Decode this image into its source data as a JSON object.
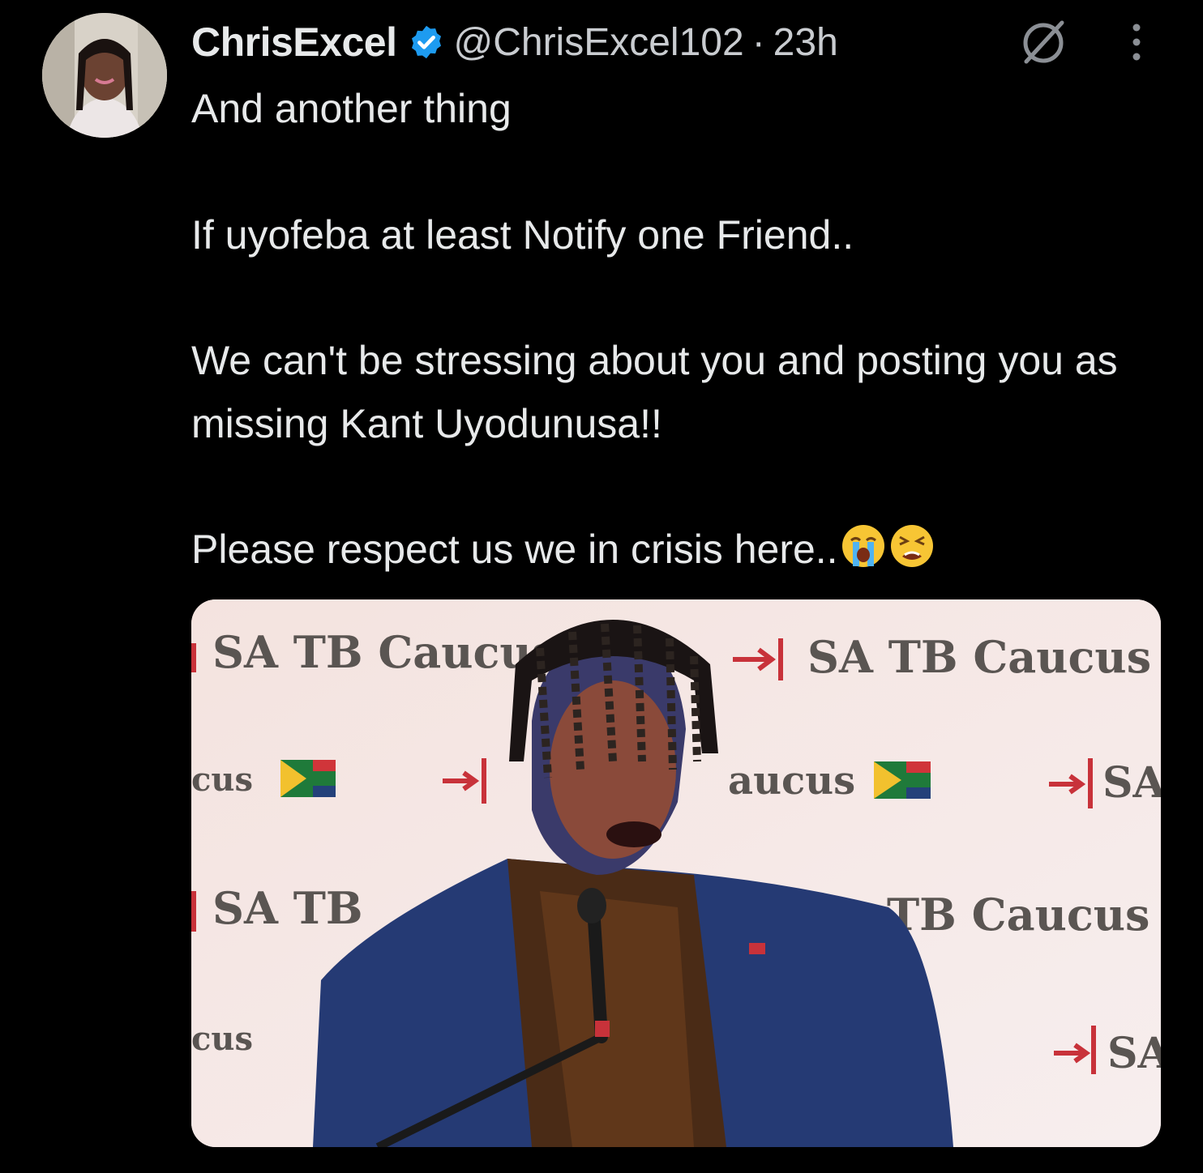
{
  "author": {
    "display_name": "ChrisExcel",
    "verified": true,
    "handle": "@ChrisExcel102",
    "separator": "·",
    "time": "23h",
    "avatar_icon": "profile-photo"
  },
  "actions": {
    "grok_icon": "grok-icon",
    "more_icon": "more-vertical-icon"
  },
  "tweet": {
    "lines": [
      "And another thing",
      "If uyofeba at least Notify one Friend..",
      "We can't be stressing about you and posting you as missing Kant Uyodunusa!!",
      "Please respect us we in crisis here.."
    ],
    "emojis": [
      "loudly-crying-face",
      "tired-face"
    ]
  },
  "media": {
    "description_icon": "photo",
    "banner_texts": [
      "SA TB Caucus",
      "SA TB Caucus",
      "cus",
      "aucus",
      "SA",
      "SA TB",
      "TB Caucus",
      "cus",
      "SA"
    ]
  },
  "colors": {
    "background": "#000000",
    "text": "#e7e9ea",
    "secondary_text": "#c9ccd0",
    "verified_blue": "#1d9bf0"
  }
}
